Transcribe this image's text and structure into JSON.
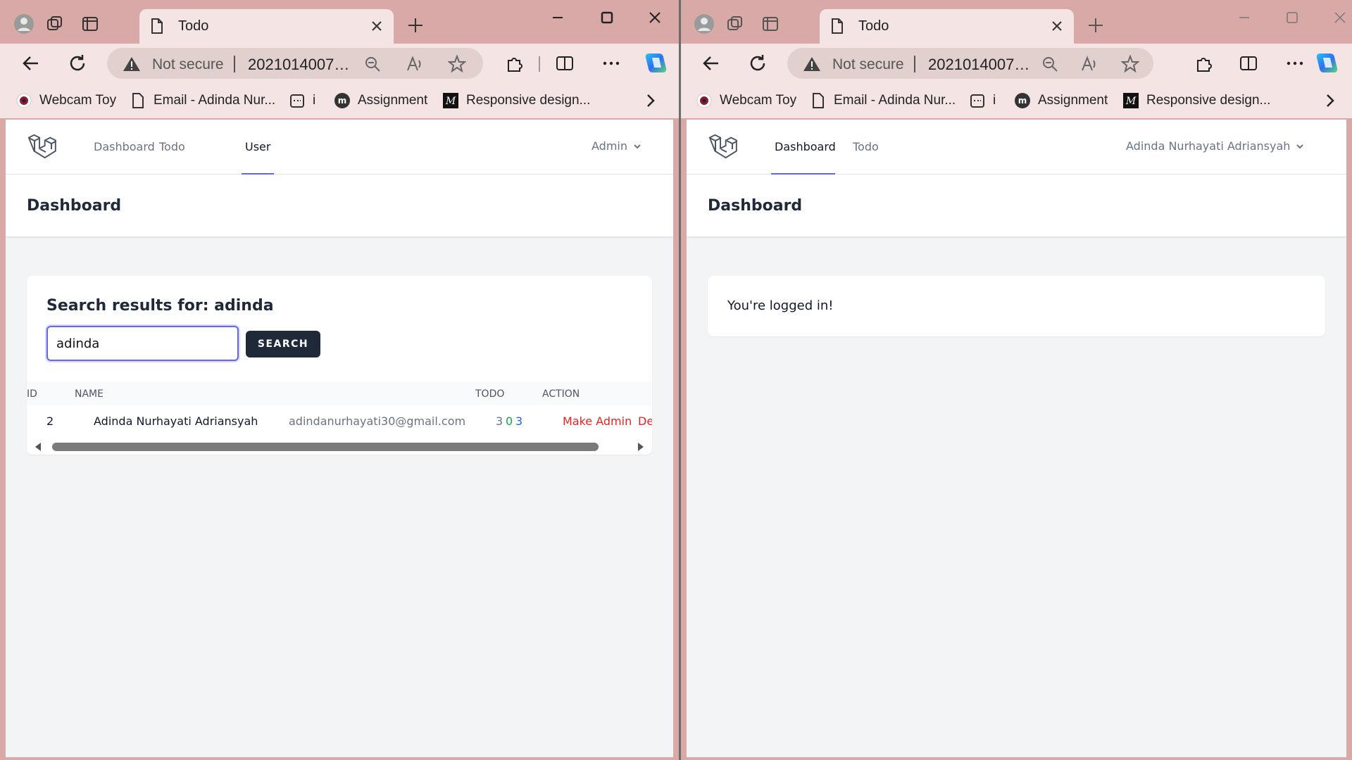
{
  "left": {
    "tab_title": "Todo",
    "address": {
      "security": "Not secure",
      "url": "202101400722..."
    },
    "bookmarks": [
      "Webcam Toy",
      "Email - Adinda Nur...",
      "i",
      "Assignment",
      "Responsive design..."
    ],
    "nav": {
      "links": [
        "Dashboard",
        "Todo",
        "User"
      ],
      "active": "User",
      "user": "Admin"
    },
    "header_title": "Dashboard",
    "search": {
      "heading": "Search results for: adinda",
      "value": "adinda",
      "button": "SEARCH"
    },
    "table": {
      "headers": [
        "ID",
        "NAME",
        "TODO",
        "ACTION"
      ],
      "rows": [
        {
          "id": "2",
          "name": "Adinda Nurhayati Adriansyah",
          "email": "adindanurhayati30@gmail.com",
          "todo": [
            "3",
            "0",
            "3"
          ],
          "make_admin": "Make Admin",
          "delete": "Del"
        }
      ]
    }
  },
  "right": {
    "tab_title": "Todo",
    "address": {
      "security": "Not secure",
      "url": "202101400722..."
    },
    "bookmarks": [
      "Webcam Toy",
      "Email - Adinda Nur...",
      "i",
      "Assignment",
      "Responsive design..."
    ],
    "nav": {
      "links": [
        "Dashboard",
        "Todo"
      ],
      "active": "Dashboard",
      "user": "Adinda Nurhayati Adriansyah"
    },
    "header_title": "Dashboard",
    "message": "You're logged in!"
  },
  "colors": {
    "accent": "#6366f1",
    "danger": "#dc2626",
    "todo_green": "#16a34a",
    "todo_blue": "#2563eb",
    "frame": "#d9a9a7",
    "chrome": "#f4e4e3"
  },
  "icons": [
    "profile-icon",
    "workspaces-icon",
    "tab-actions-icon",
    "page-icon",
    "close-icon",
    "plus-icon",
    "minimize-icon",
    "maximize-icon",
    "back-icon",
    "refresh-icon",
    "warning-icon",
    "zoom-icon",
    "read-aloud-icon",
    "favorite-icon",
    "extensions-icon",
    "split-screen-icon",
    "more-icon",
    "copilot-icon",
    "laravel-logo",
    "chevron-down-icon"
  ]
}
